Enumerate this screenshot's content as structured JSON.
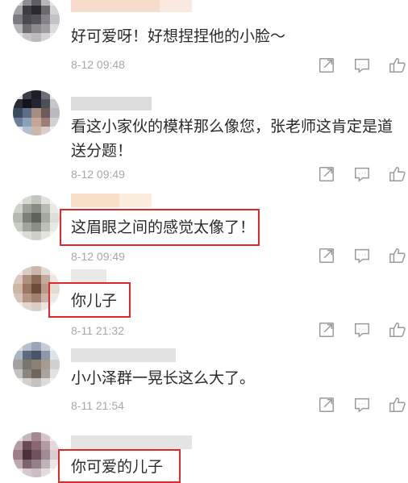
{
  "comments": [
    {
      "text": "好可爱呀！好想捏捏他的小脸～",
      "time": "8-12 09:48"
    },
    {
      "text": "看这小家伙的模样那么像您，张老师这肯定是道\n送分题！",
      "time": "8-12 09:49"
    },
    {
      "text": "这眉眼之间的感觉太像了！",
      "time": "8-12 09:49"
    },
    {
      "text": "你儿子",
      "time": "8-11 21:32"
    },
    {
      "text": "小小泽群一晃长这么大了。",
      "time": "8-11 21:54"
    },
    {
      "text": "你可爱的儿子",
      "time": ""
    }
  ],
  "actions": {
    "share_icon": "share-icon",
    "reply_icon": "reply-icon",
    "like_icon": "thumbs-up-icon"
  },
  "colors": {
    "highlight": "#e0272a",
    "timestamp": "#a8a8a8",
    "icon": "#9a9a9a",
    "text": "#2a2a2a"
  }
}
